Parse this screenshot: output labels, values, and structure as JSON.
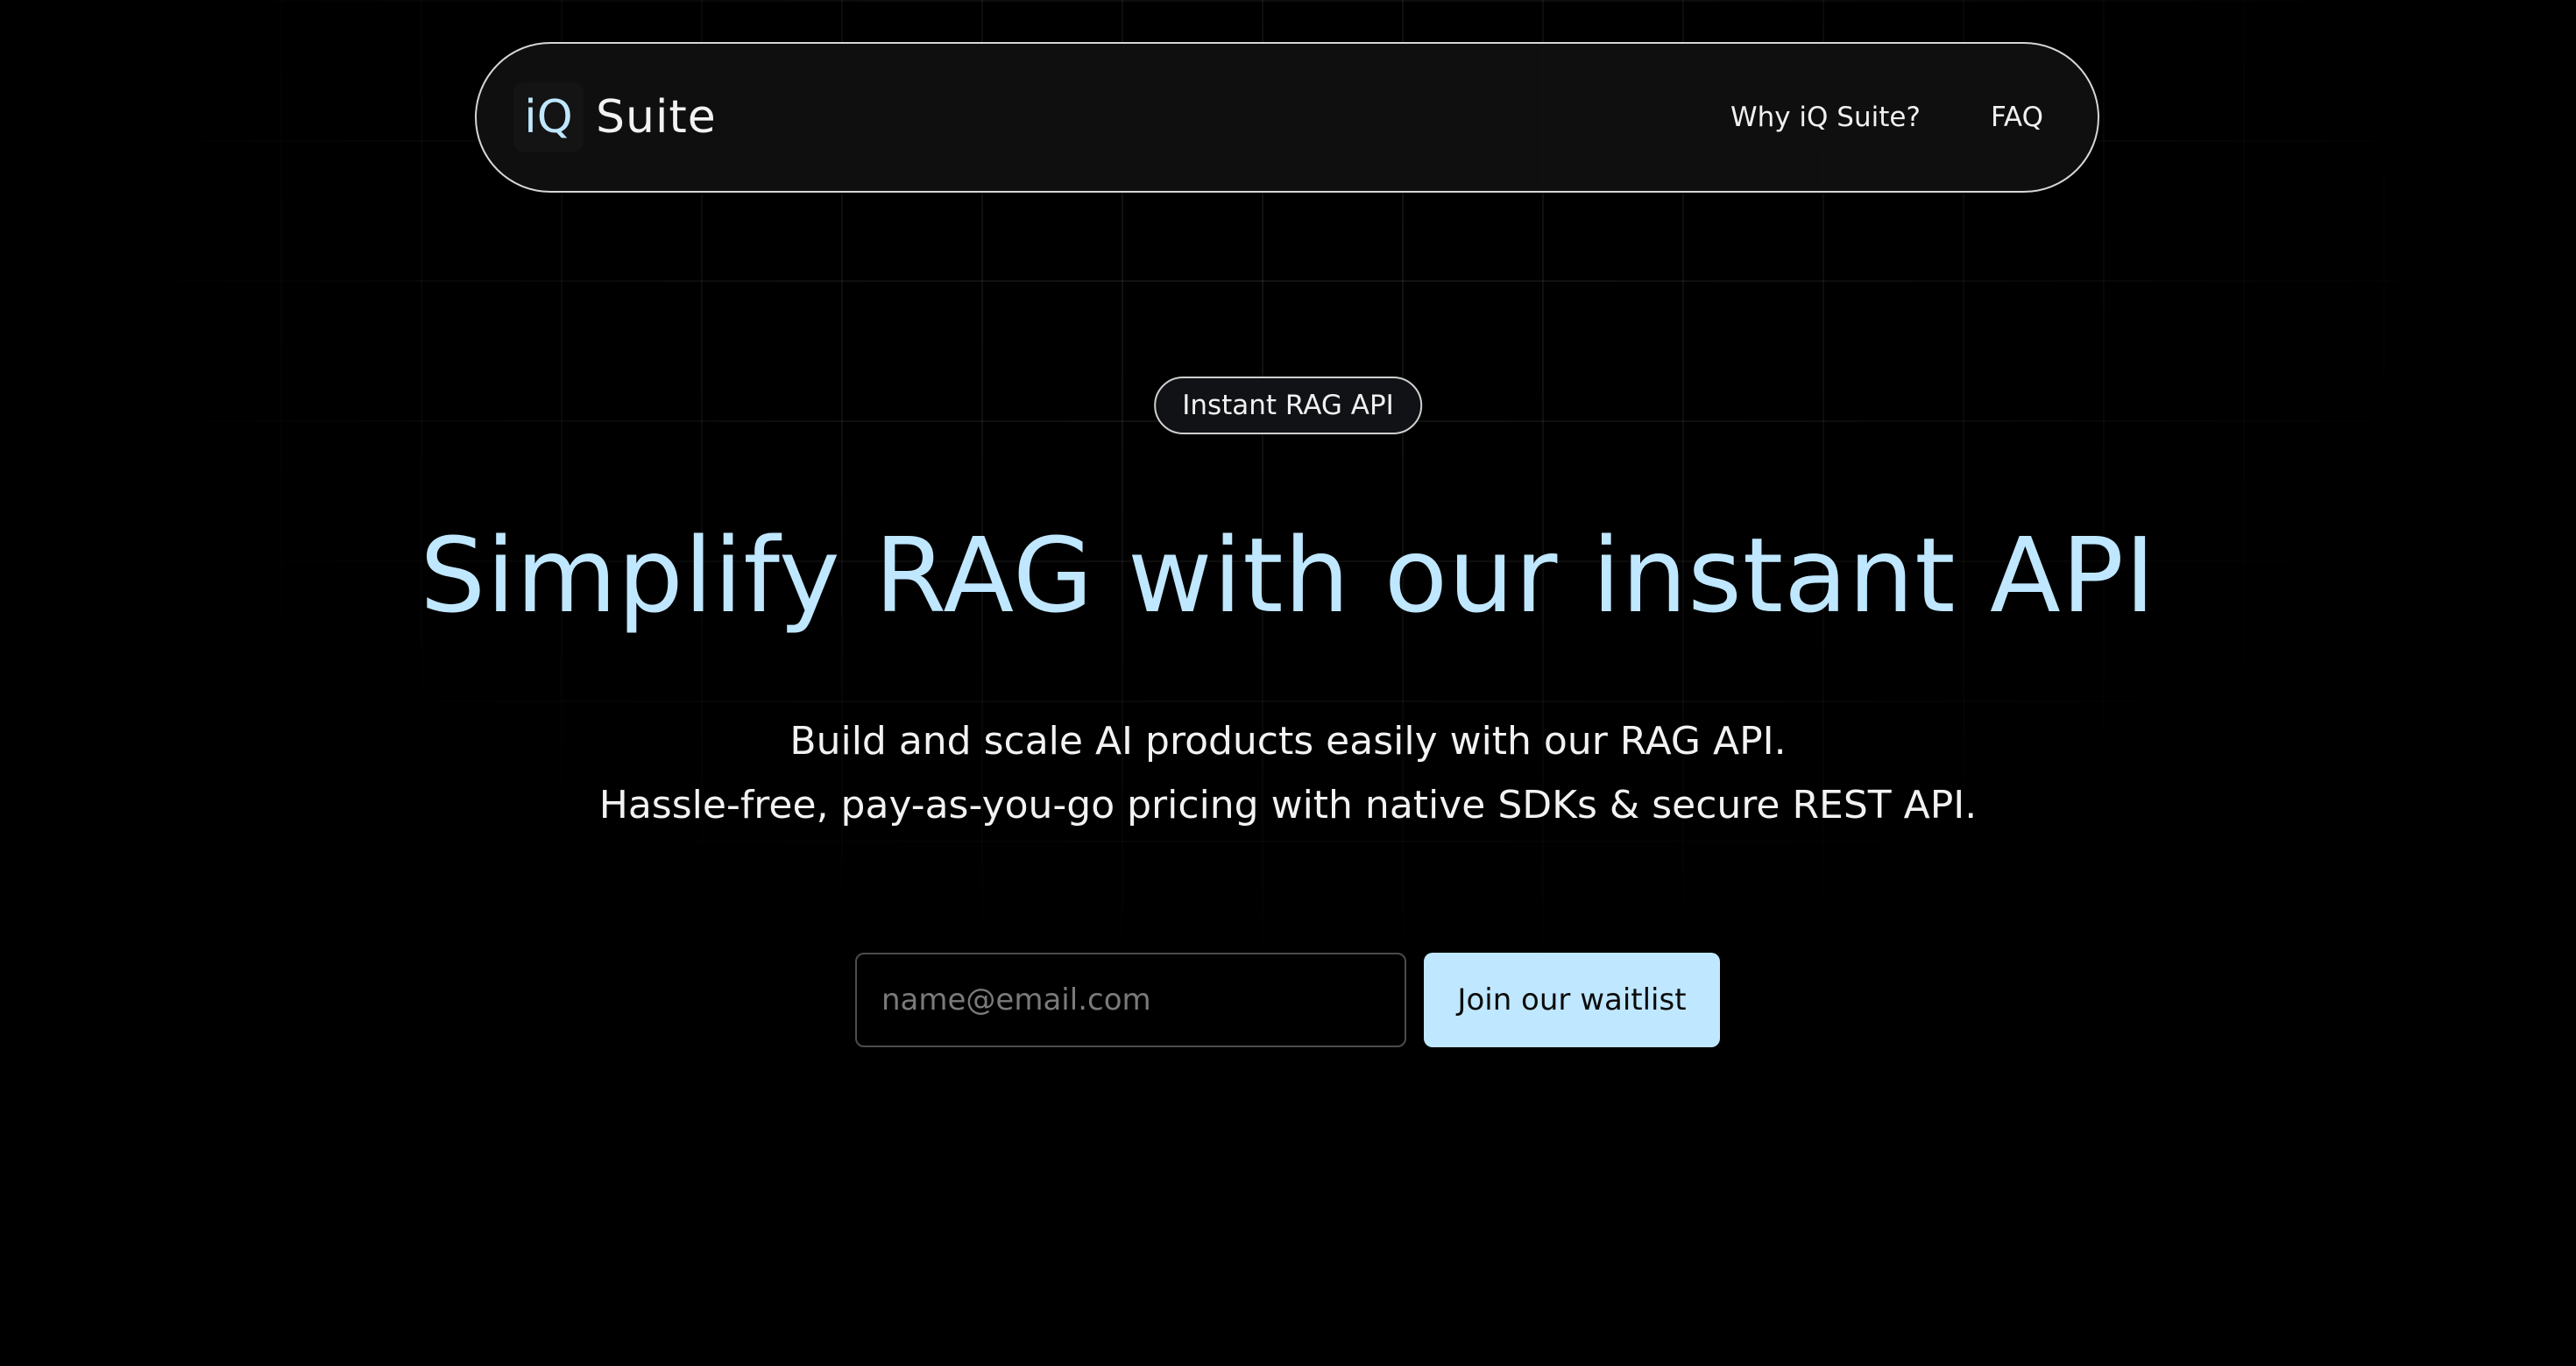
{
  "brand": {
    "mark": "iQ",
    "name": "Suite"
  },
  "nav": {
    "links": [
      {
        "label": "Why iQ Suite?"
      },
      {
        "label": "FAQ"
      }
    ]
  },
  "hero": {
    "badge": "Instant RAG API",
    "headline": "Simplify RAG with our instant API",
    "sub_line_1": "Build and scale AI products easily with our RAG API.",
    "sub_line_2": "Hassle-free, pay-as-you-go pricing with native SDKs & secure REST API."
  },
  "waitlist": {
    "email_placeholder": "name@email.com",
    "email_value": "",
    "button_label": "Join our waitlist"
  },
  "colors": {
    "background": "#000000",
    "accent": "#bfe7ff",
    "text": "#f2f2f2"
  }
}
